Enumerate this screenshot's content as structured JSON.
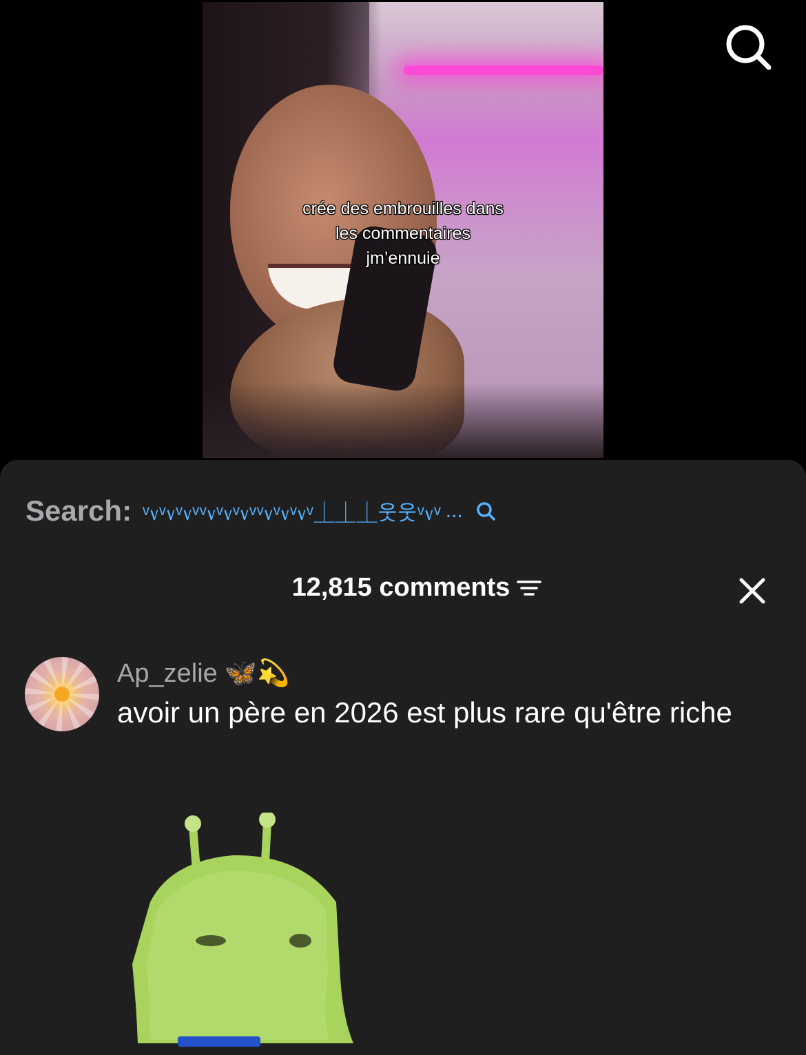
{
  "video": {
    "caption_lines": [
      "crée des embrouilles dans",
      "les commentaires",
      "jm’ennuie"
    ]
  },
  "top_bar": {
    "search_icon": "search-icon"
  },
  "comments_sheet": {
    "search": {
      "label": "Search:",
      "query": "ᵛ᥎ᵛ᥎ᵛ᥎ᵛᵛ᥎ᵛ᥎ᵛ᥎ᵛᵛ᥎ᵛ᥎ᵛ᥎ᵛ⏊⏊⏊웃웃ᵛ᥎ᵛ",
      "ellipsis": "...",
      "icon": "search-icon"
    },
    "header": {
      "count_label": "12,815 comments",
      "filter_icon": "filter-icon",
      "close_icon": "close-icon"
    },
    "comments": [
      {
        "username": "Ap_zelie",
        "username_emojis": "🦋💫",
        "text": "avoir un père en 2026 est plus rare qu'être riche",
        "avatar": "avatar",
        "sticker": "green-alien-cat-sticker"
      }
    ]
  },
  "colors": {
    "background": "#000000",
    "sheet": "#1f1f20",
    "search_query": "#56b3ff",
    "muted_text": "#a7a7ab",
    "neon": "#ff4ad8",
    "sticker_green": "#a8d35c"
  }
}
